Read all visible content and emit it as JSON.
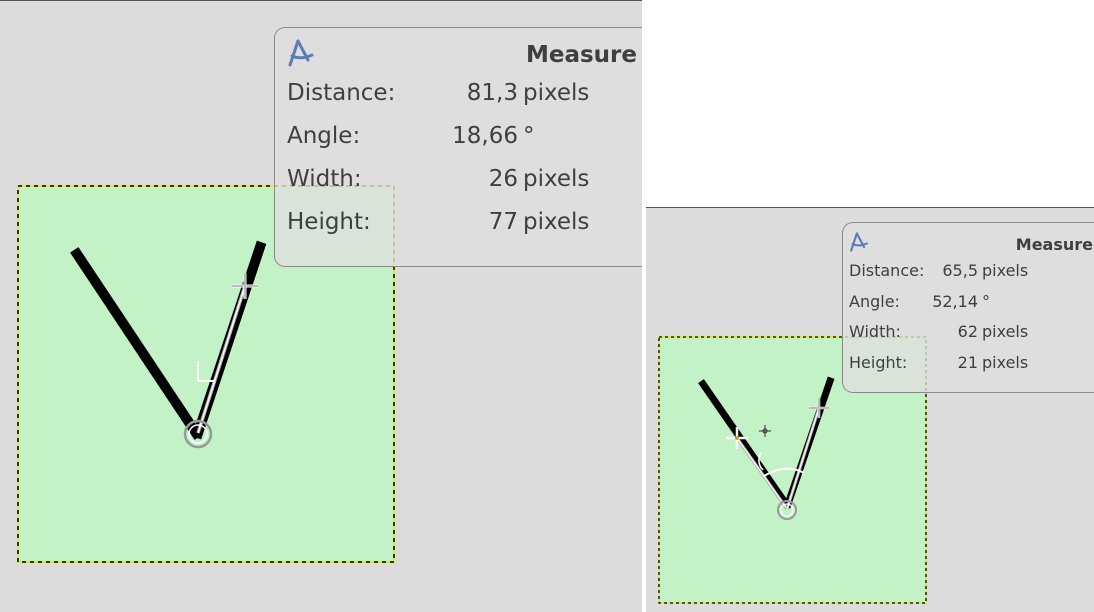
{
  "colors": {
    "canvas_background": "#dcdcdc",
    "selection_fill": "#c2f2c6",
    "selection_border": "#e8e800",
    "stroke": "#000000",
    "tooltip_text": "#3f3f3f",
    "measure_icon": "#5d7cb3"
  },
  "panels": [
    {
      "tool_icon": "measure-compass-icon",
      "title": "Measure",
      "rows": [
        {
          "label": "Distance:",
          "value": "81,3",
          "unit": "pixels"
        },
        {
          "label": "Angle:",
          "value": "18,66",
          "unit": "°"
        },
        {
          "label": "Width:",
          "value": "26",
          "unit": "pixels"
        },
        {
          "label": "Height:",
          "value": "77",
          "unit": "pixels"
        }
      ]
    },
    {
      "tool_icon": "measure-compass-icon",
      "title": "Measure",
      "rows": [
        {
          "label": "Distance:",
          "value": "65,5",
          "unit": "pixels"
        },
        {
          "label": "Angle:",
          "value": "52,14",
          "unit": "°"
        },
        {
          "label": "Width:",
          "value": "62",
          "unit": "pixels"
        },
        {
          "label": "Height:",
          "value": "21",
          "unit": "pixels"
        }
      ]
    }
  ]
}
